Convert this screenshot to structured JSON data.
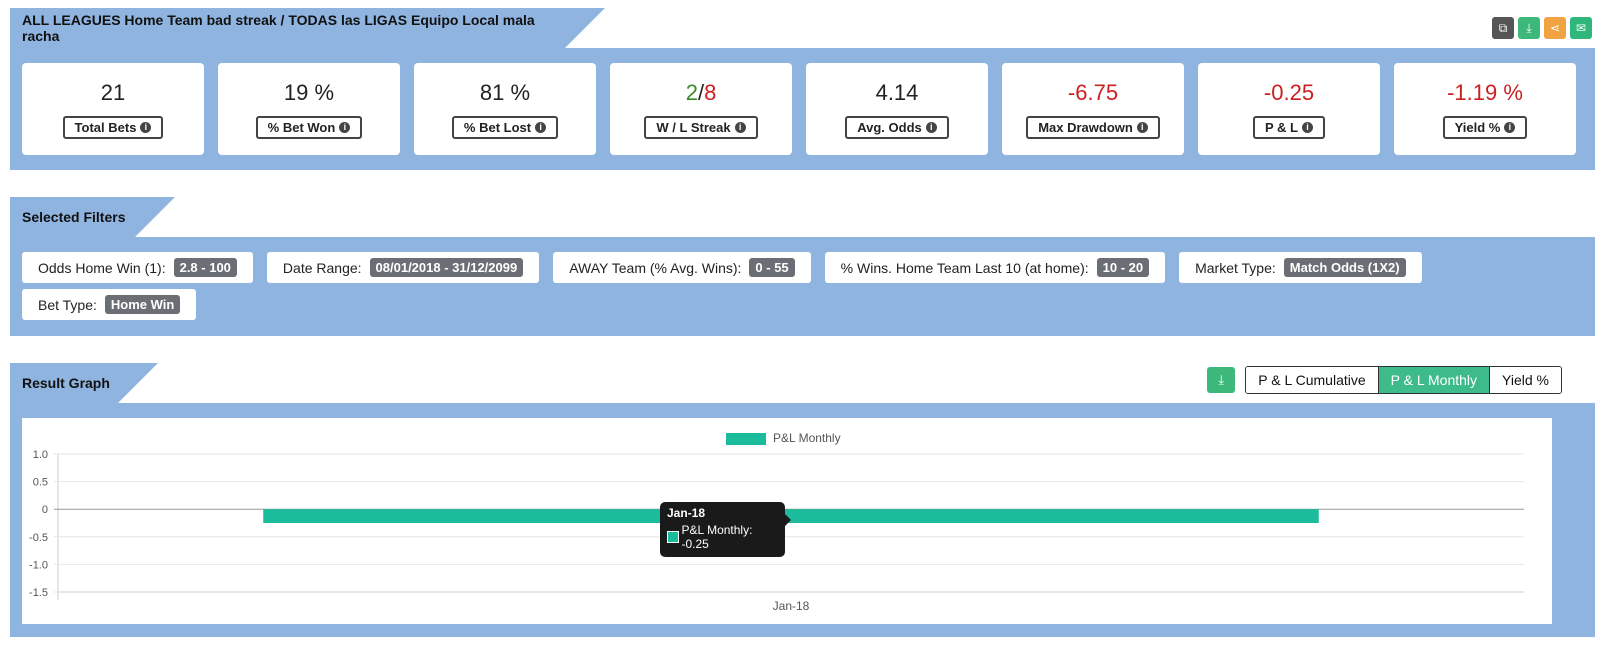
{
  "header": {
    "title": "ALL LEAGUES Home Team bad streak / TODAS las LIGAS Equipo Local mala racha"
  },
  "actions": [
    {
      "name": "copy-icon",
      "glyph": "⧉"
    },
    {
      "name": "download-icon",
      "glyph": "⤓"
    },
    {
      "name": "share-icon",
      "glyph": "⋖"
    },
    {
      "name": "mail-icon",
      "glyph": "✉"
    }
  ],
  "stats": [
    {
      "value": "21",
      "label": "Total Bets",
      "negative": false
    },
    {
      "value": "19 %",
      "label": "% Bet Won",
      "negative": false
    },
    {
      "value": "81 %",
      "label": "% Bet Lost",
      "negative": false
    },
    {
      "value": "",
      "label": "W / L Streak",
      "negative": false
    },
    {
      "value": "4.14",
      "label": "Avg. Odds",
      "negative": false
    },
    {
      "value": "-6.75",
      "label": "Max Drawdown",
      "negative": true
    },
    {
      "value": "-0.25",
      "label": "P & L",
      "negative": true
    },
    {
      "value": "-1.19 %",
      "label": "Yield %",
      "negative": true
    }
  ],
  "streak": {
    "wins": "2",
    "sep": "/",
    "losses": "8"
  },
  "filters_section": {
    "title": "Selected Filters"
  },
  "filters": [
    {
      "label": "Odds Home Win (1):",
      "value": "2.8 - 100"
    },
    {
      "label": "Date Range:",
      "value": "08/01/2018 - 31/12/2099"
    },
    {
      "label": "AWAY Team (% Avg. Wins):",
      "value": "0 - 55"
    },
    {
      "label": "% Wins. Home Team Last 10 (at home):",
      "value": "10 - 20"
    },
    {
      "label": "Market Type:",
      "value": "Match Odds (1X2)"
    },
    {
      "label": "Bet Type:",
      "value": "Home Win"
    }
  ],
  "graph_section": {
    "title": "Result Graph",
    "views": [
      "P & L Cumulative",
      "P & L Monthly",
      "Yield %"
    ],
    "active_view": "P & L Monthly"
  },
  "tooltip": {
    "title": "Jan-18",
    "text": "P&L Monthly: -0.25"
  },
  "colors": {
    "accent": "#1abc9c",
    "panel": "#8fb4e0",
    "negative": "#cc1f1f",
    "positive": "#3b8a2a"
  },
  "chart_data": {
    "type": "bar",
    "categories": [
      "Jan-18"
    ],
    "series": [
      {
        "name": "P&L Monthly",
        "values": [
          -0.25
        ]
      }
    ],
    "ylim": [
      -1.5,
      1.0
    ],
    "yticks": [
      "1.0",
      "0.5",
      "0",
      "-0.5",
      "-1.0",
      "-1.5"
    ],
    "legend": "top-center",
    "grid": true
  }
}
